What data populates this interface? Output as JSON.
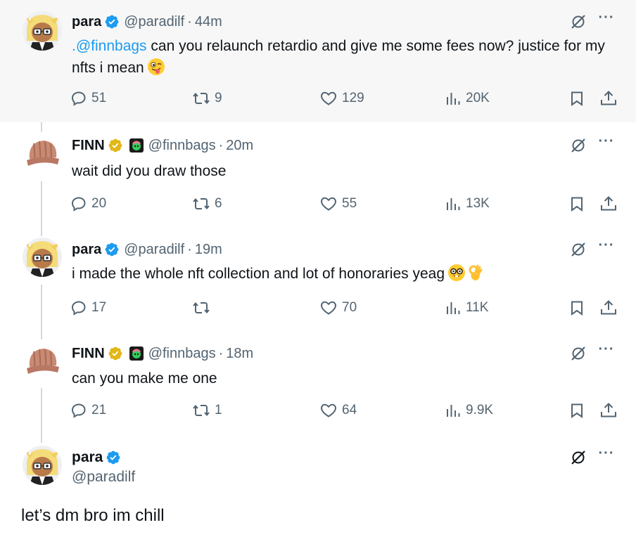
{
  "tweets": [
    {
      "name": "para",
      "handle": "@paradilf",
      "time": "44m",
      "mention": ".@finnbags",
      "text": " can you relaunch retardio and give me some fees now? justice for my nfts i mean",
      "emoji": "winking-face-with-tongue",
      "replies": "51",
      "retweets": "9",
      "likes": "129",
      "views": "20K"
    },
    {
      "name": "FINN",
      "handle": "@finnbags",
      "time": "20m",
      "text": "wait did you draw those",
      "replies": "20",
      "retweets": "6",
      "likes": "55",
      "views": "13K"
    },
    {
      "name": "para",
      "handle": "@paradilf",
      "time": "19m",
      "text": "i made the whole nft collection and lot of honoraries yeag",
      "emoji": [
        "nerd-face",
        "ok-hand"
      ],
      "replies": "17",
      "retweets": "",
      "likes": "70",
      "views": "11K"
    },
    {
      "name": "FINN",
      "handle": "@finnbags",
      "time": "18m",
      "text": "can you make me one",
      "replies": "21",
      "retweets": "1",
      "likes": "64",
      "views": "9.9K"
    }
  ],
  "main_tweet": {
    "name": "para",
    "handle": "@paradilf",
    "text": "let’s dm bro im chill"
  },
  "separator": "·",
  "colors": {
    "verified_blue": "#1d9bf0",
    "verified_gold": "#e2b719",
    "link": "#1d9bf0",
    "secondary": "#536471",
    "highlight_bg": "#f7f7f7"
  }
}
